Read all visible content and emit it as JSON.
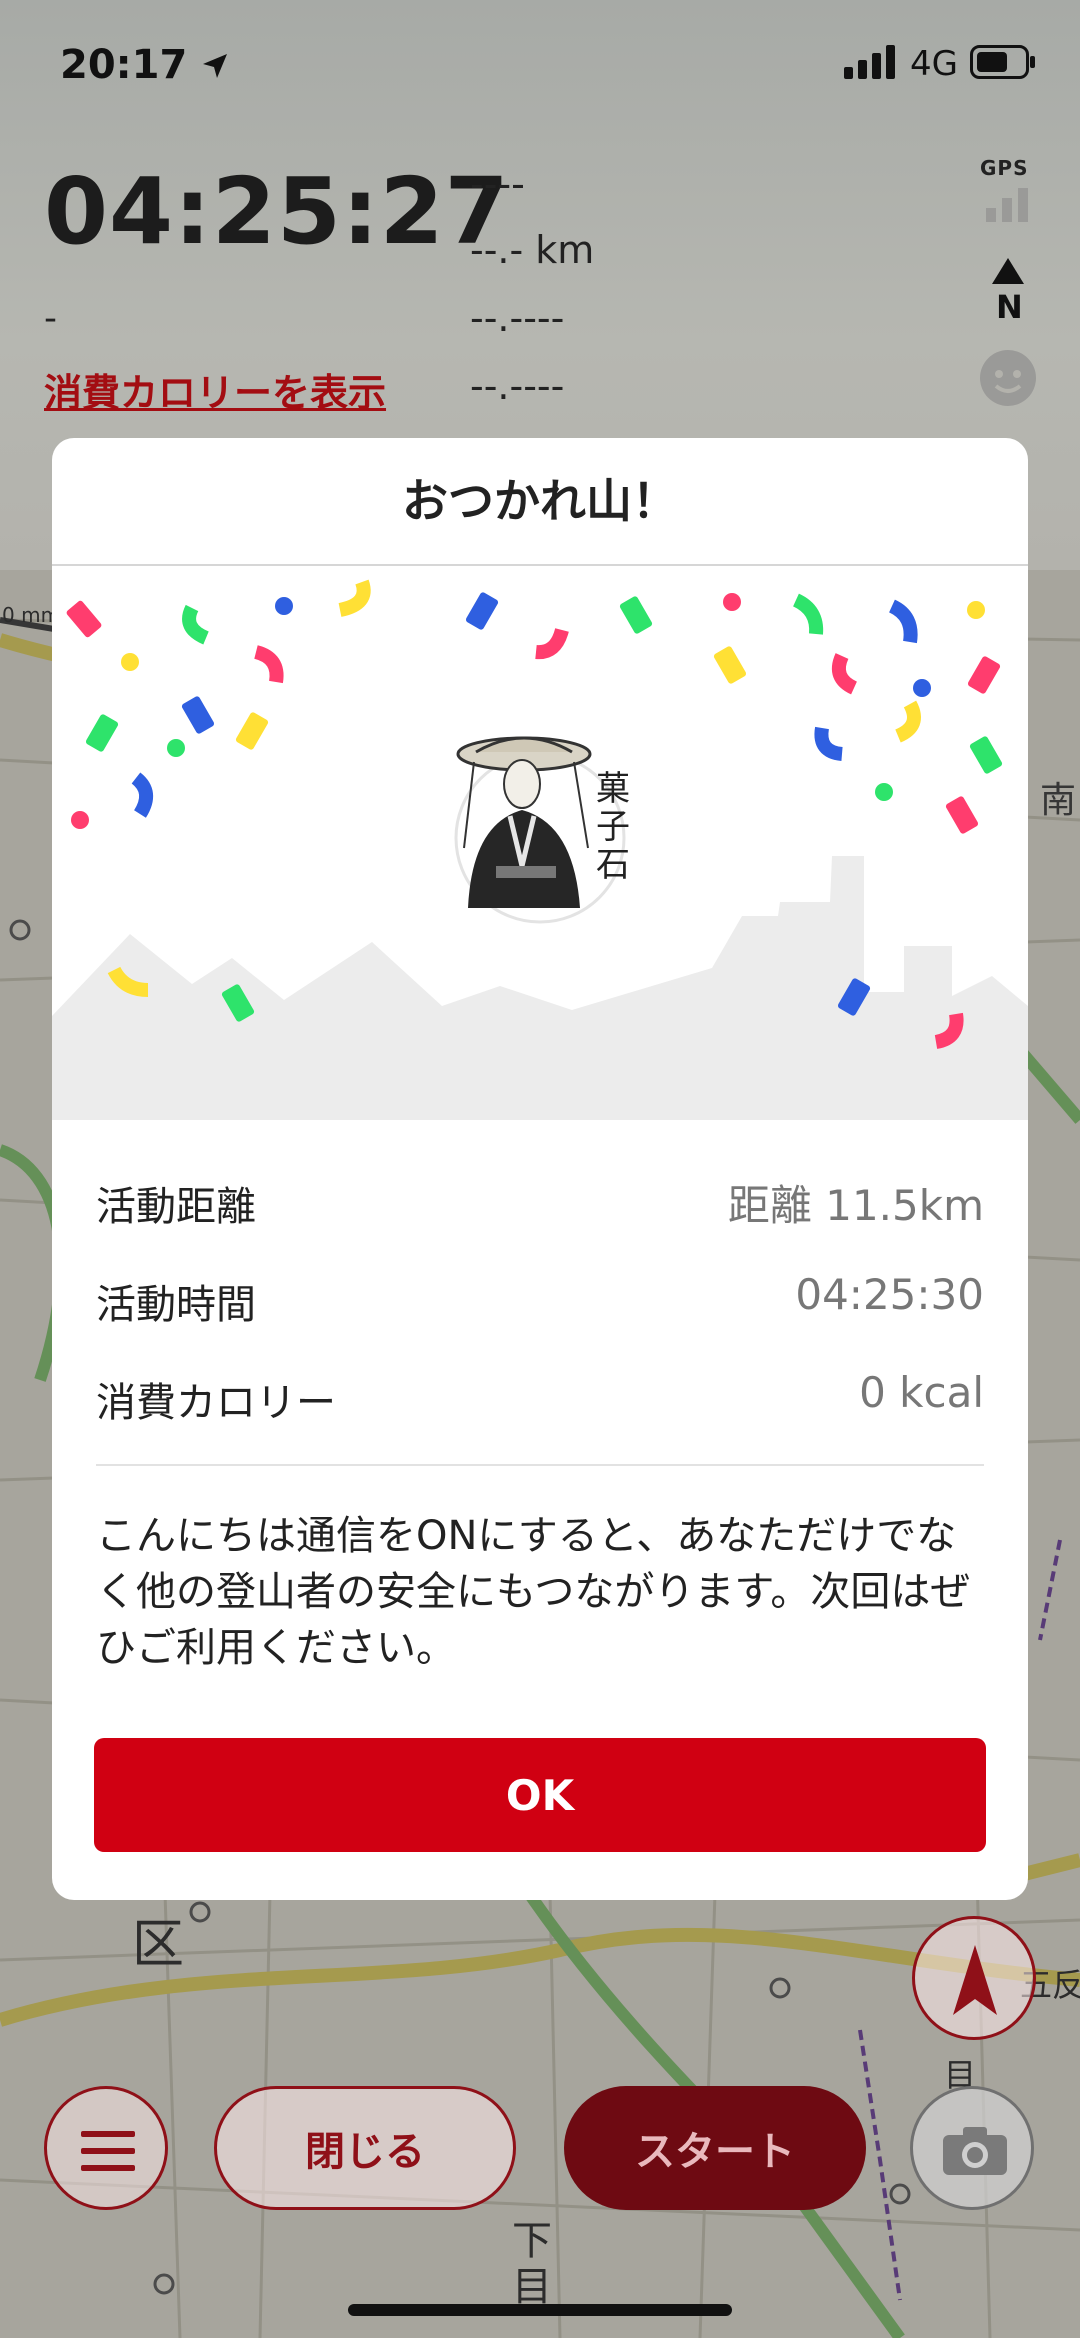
{
  "status_bar": {
    "time": "20:17",
    "network": "4G",
    "icons": [
      "location-arrow-icon",
      "signal-bars-icon",
      "battery-icon"
    ]
  },
  "tracker": {
    "elapsed": "04:25:27",
    "left_placeholder": "-",
    "calorie_link": "消費カロリーを表示",
    "metric_1": "----",
    "metric_2": "--.- km",
    "metric_3": "--.----",
    "metric_4": "--.----",
    "gps_label": "GPS"
  },
  "modal": {
    "title": "おつかれ山！",
    "stats": [
      {
        "label": "活動距離",
        "value": "距離 11.5km"
      },
      {
        "label": "活動時間",
        "value": "04:25:30"
      },
      {
        "label": "消費カロリー",
        "value": "0 kcal"
      }
    ],
    "message": "こんにちは通信をONにすると、あなただけでなく他の登山者の安全にもつながります。次回はぜひご利用ください。",
    "ok_label": "OK"
  },
  "bottom_bar": {
    "close_label": "閉じる",
    "start_label": "スタート",
    "icons": [
      "menu-icon",
      "compass-icon",
      "camera-icon"
    ]
  },
  "map_labels": {
    "ward": "区",
    "right_char": "南",
    "lower_chars": [
      "下",
      "目"
    ],
    "tag_right": "五反",
    "tag_eye": "目"
  },
  "colors": {
    "accent_red": "#d00012",
    "link_red": "#a30d12"
  }
}
